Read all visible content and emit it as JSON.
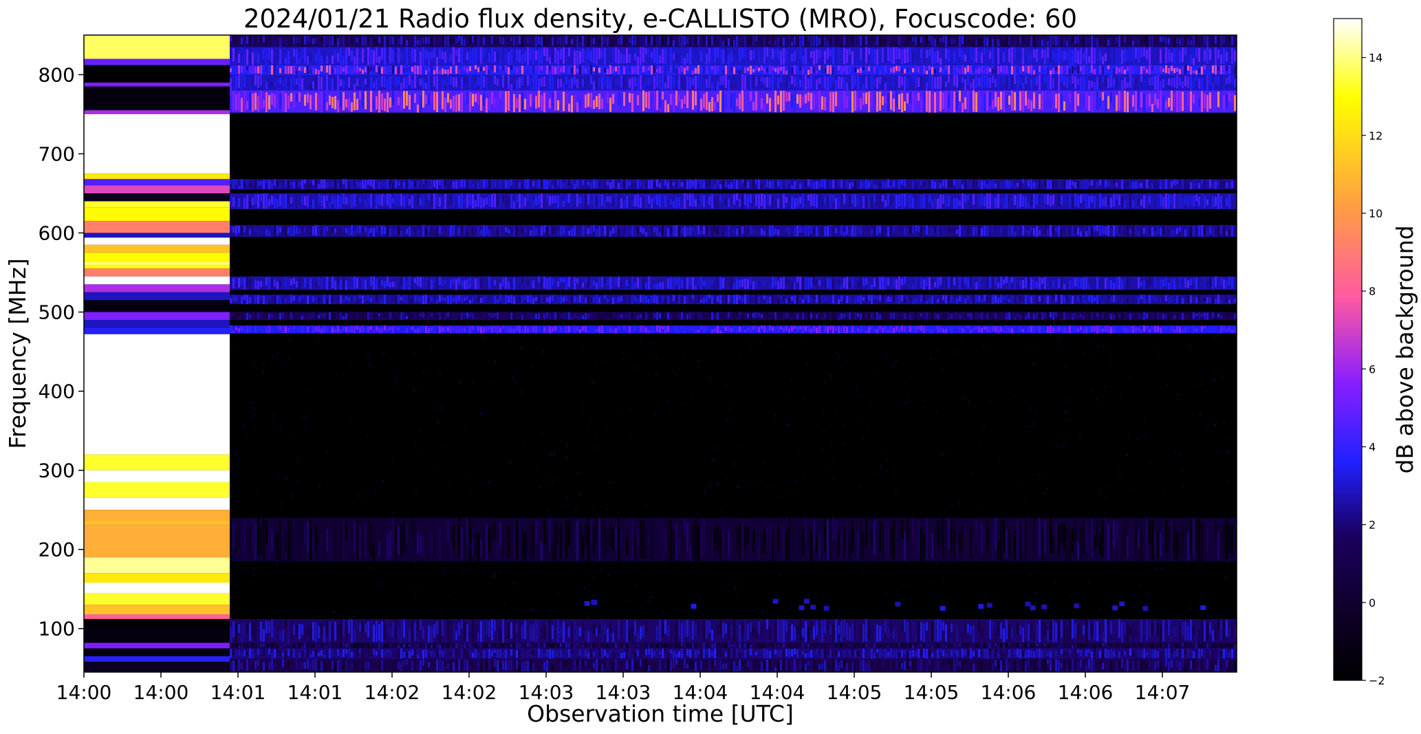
{
  "chart_data": {
    "type": "heatmap",
    "title": "2024/01/21  Radio flux density, e-CALLISTO (MRO), Focuscode: 60",
    "xlabel": "Observation time [UTC]",
    "ylabel": "Frequency [MHz]",
    "x_tick_labels": [
      "14:00",
      "14:00",
      "14:01",
      "14:01",
      "14:02",
      "14:02",
      "14:03",
      "14:03",
      "14:04",
      "14:04",
      "14:05",
      "14:05",
      "14:06",
      "14:06",
      "14:07"
    ],
    "y_ticks": [
      100,
      200,
      300,
      400,
      500,
      600,
      700,
      800
    ],
    "ylim": [
      45,
      850
    ],
    "colorbar": {
      "label": "dB above background",
      "range": [
        -2,
        15
      ],
      "ticks": [
        -2,
        0,
        2,
        4,
        6,
        8,
        10,
        12,
        14
      ],
      "colormap": "gnuplot2",
      "stops": [
        "#000000",
        "#1a0050",
        "#2020ff",
        "#8a1fff",
        "#ff5aa0",
        "#ffa040",
        "#ffff00",
        "#ffffff"
      ]
    },
    "bands": [
      {
        "freq_low": 45,
        "freq_high": 62,
        "level_db": 0.6,
        "note": "blue band"
      },
      {
        "freq_low": 62,
        "freq_high": 75,
        "level_db": 1.5,
        "note": "blue band"
      },
      {
        "freq_low": 75,
        "freq_high": 82,
        "level_db": 0.2,
        "note": "dark"
      },
      {
        "freq_low": 82,
        "freq_high": 112,
        "level_db": 1.2,
        "note": "blue band"
      },
      {
        "freq_low": 185,
        "freq_high": 240,
        "level_db": -0.6,
        "note": "faint drifting structure"
      },
      {
        "freq_low": 473,
        "freq_high": 483,
        "level_db": 4.0,
        "note": "bright spiky band"
      },
      {
        "freq_low": 490,
        "freq_high": 500,
        "level_db": 1.0,
        "note": "blue"
      },
      {
        "freq_low": 510,
        "freq_high": 522,
        "level_db": 2.2,
        "note": "blue"
      },
      {
        "freq_low": 528,
        "freq_high": 545,
        "level_db": 2.5,
        "note": "blue"
      },
      {
        "freq_low": 595,
        "freq_high": 610,
        "level_db": 2.0,
        "note": "blue"
      },
      {
        "freq_low": 630,
        "freq_high": 650,
        "level_db": 2.6,
        "note": "blue"
      },
      {
        "freq_low": 655,
        "freq_high": 668,
        "level_db": 2.2,
        "note": "blue"
      },
      {
        "freq_low": 752,
        "freq_high": 780,
        "level_db": 6.0,
        "note": "spiky pink/white emission"
      },
      {
        "freq_low": 780,
        "freq_high": 800,
        "level_db": 3.0,
        "note": "blue/purple"
      },
      {
        "freq_low": 800,
        "freq_high": 812,
        "level_db": 4.5,
        "note": "purple"
      },
      {
        "freq_low": 812,
        "freq_high": 835,
        "level_db": 3.2,
        "note": "blue/purple"
      },
      {
        "freq_low": 835,
        "freq_high": 850,
        "level_db": 1.0,
        "note": "blue"
      }
    ],
    "saturated_start_block": {
      "time_range": [
        "14:00",
        "14:01"
      ],
      "note": "calibration/saturated segment in yellow-white with horizontal stripes"
    }
  }
}
